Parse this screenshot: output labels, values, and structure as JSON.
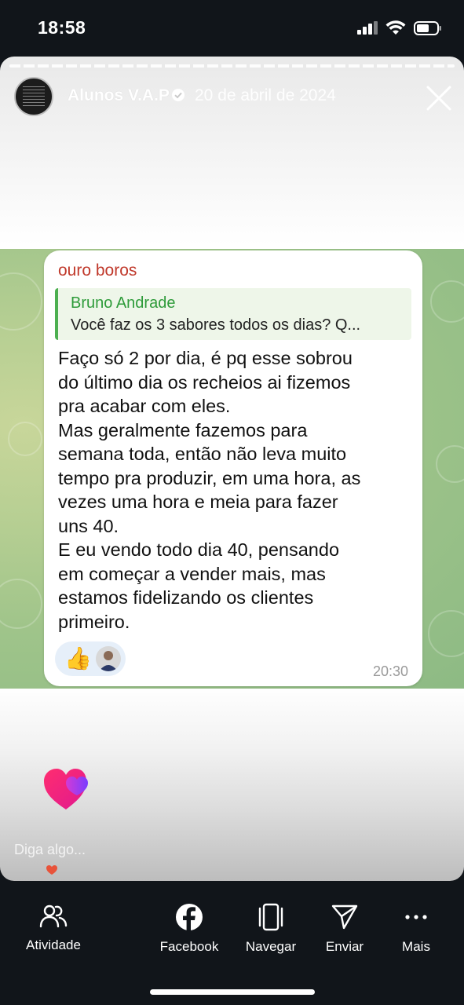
{
  "status_bar": {
    "time": "18:58"
  },
  "story": {
    "author": "Alunos V.A.P",
    "date": "20 de abril de 2024",
    "chat": {
      "sender": "ouro boros",
      "reply_to": {
        "name": "Bruno Andrade",
        "text": "Você faz os 3 sabores todos os dias? Q..."
      },
      "message": "Faço só 2 por dia, é pq esse sobrou\ndo último dia os recheios ai fizemos\npra acabar com eles.\nMas geralmente fazemos para\nsemana toda, então não leva muito\ntempo pra produzir, em uma hora, as\nvezes uma hora e meia para fazer\nuns 40.\nE eu vendo todo dia 40, pensando\nem começar a vender mais, mas\nestamos fidelizando os clientes\nprimeiro.",
      "reaction_emoji": "👍",
      "time": "20:30"
    },
    "reply_placeholder": "Diga algo..."
  },
  "bottom_nav": {
    "items": [
      {
        "label": "Atividade",
        "icon": "people-icon"
      },
      {
        "label": "Facebook",
        "icon": "facebook-icon"
      },
      {
        "label": "Navegar",
        "icon": "browse-icon"
      },
      {
        "label": "Enviar",
        "icon": "send-icon"
      },
      {
        "label": "Mais",
        "icon": "more-icon"
      }
    ]
  },
  "colors": {
    "sender_name": "#c0392b",
    "reply_accent": "#4caf50",
    "background": "#11151a"
  }
}
